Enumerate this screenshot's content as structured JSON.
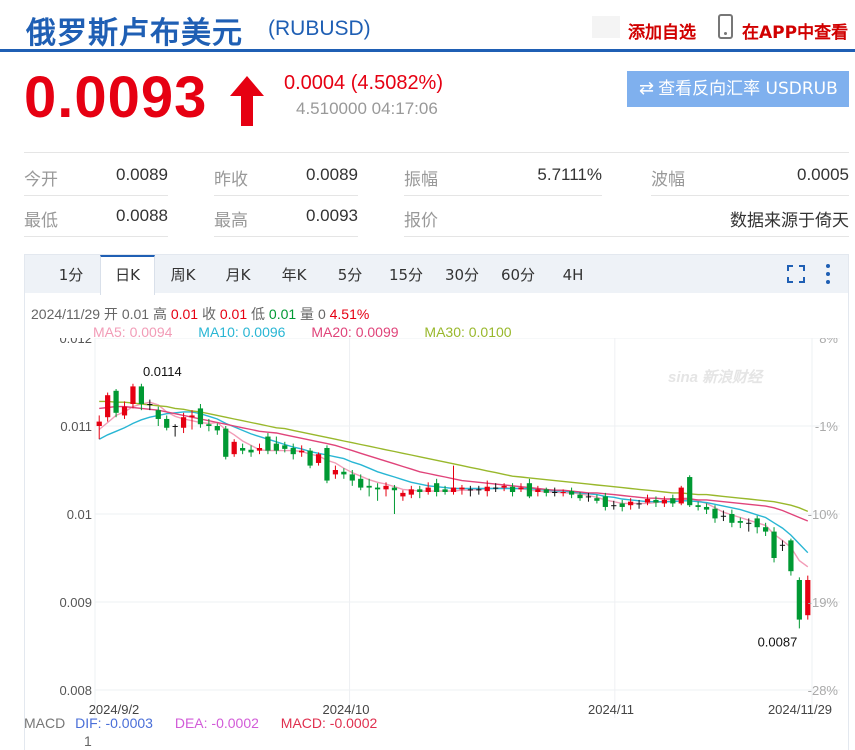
{
  "header": {
    "title": "俄罗斯卢布美元",
    "symbol": "(RUBUSD)",
    "add_favorite": "添加自选",
    "app_view": "在APP中查看"
  },
  "quote": {
    "price": "0.0093",
    "change": "0.0004 (4.5082%)",
    "sub_info": "4.510000 04:17:06",
    "reverse_button": "查看反向汇率 USDRUB"
  },
  "stats": {
    "row1": [
      {
        "label": "今开",
        "value": "0.0089"
      },
      {
        "label": "昨收",
        "value": "0.0089"
      },
      {
        "label": "振幅",
        "value": "5.7111%"
      },
      {
        "label": "波幅",
        "value": "0.0005"
      }
    ],
    "row2": [
      {
        "label": "最低",
        "value": "0.0088"
      },
      {
        "label": "最高",
        "value": "0.0093"
      },
      {
        "label": "报价",
        "value": "数据来源于倚天"
      }
    ]
  },
  "tabs": [
    "1分",
    "日K",
    "周K",
    "月K",
    "年K",
    "5分",
    "15分",
    "30分",
    "60分",
    "4H"
  ],
  "active_tab": "日K",
  "ohlc": {
    "date": "2024/11/29",
    "open_label": "开",
    "open": "0.01",
    "high_label": "高",
    "high": "0.01",
    "close_label": "收",
    "close": "0.01",
    "low_label": "低",
    "low": "0.01",
    "volume_label": "量",
    "volume": "0",
    "change_pct": "4.51%"
  },
  "ma": {
    "ma5": "MA5: 0.0094",
    "ma10": "MA10: 0.0096",
    "ma20": "MA20: 0.0099",
    "ma30": "MA30: 0.0100"
  },
  "macd": {
    "label": "MACD",
    "dif": "DIF: -0.0003",
    "dea": "DEA: -0.0002",
    "macd": "MACD: -0.0002",
    "axis_value": "1"
  },
  "colors": {
    "up": "#e60012",
    "down": "#009933",
    "ma5": "#f29cb7",
    "ma10": "#29b6d4",
    "ma20": "#e0447a",
    "ma30": "#99b82c"
  },
  "chart_data": {
    "type": "candlestick",
    "y_ticks": [
      "0.012",
      "0.011",
      "0.01",
      "0.009",
      "0.008"
    ],
    "y_tick_values": [
      0.012,
      0.011,
      0.01,
      0.009,
      0.008
    ],
    "pct_ticks": [
      "8%",
      "-1%",
      "-10%",
      "-19%",
      "-28%"
    ],
    "x_ticks": [
      "2024/9/2",
      "2024/10",
      "2024/11",
      "2024/11/29"
    ],
    "ylim": [
      0.008,
      0.012
    ],
    "max_label": "0.0114",
    "min_label": "0.0087",
    "watermark": "sina 新浪财经",
    "candles": [
      [
        0.011,
        0.01105,
        0.01112,
        0.01085
      ],
      [
        0.0111,
        0.01135,
        0.01138,
        0.01105
      ],
      [
        0.0114,
        0.01115,
        0.01142,
        0.0111
      ],
      [
        0.01112,
        0.01122,
        0.01128,
        0.01108
      ],
      [
        0.01125,
        0.01145,
        0.01148,
        0.0112
      ],
      [
        0.01145,
        0.01125,
        0.01148,
        0.01118
      ],
      [
        0.01125,
        0.01125,
        0.0113,
        0.01118
      ],
      [
        0.01118,
        0.01108,
        0.01122,
        0.011
      ],
      [
        0.01108,
        0.01098,
        0.01112,
        0.01095
      ],
      [
        0.011,
        0.011,
        0.01102,
        0.01088
      ],
      [
        0.01098,
        0.0111,
        0.01115,
        0.01092
      ],
      [
        0.0111,
        0.01112,
        0.01118,
        0.01096
      ],
      [
        0.0112,
        0.01102,
        0.01125,
        0.01098
      ],
      [
        0.01102,
        0.011,
        0.01108,
        0.01094
      ],
      [
        0.011,
        0.01095,
        0.01103,
        0.0109
      ],
      [
        0.01097,
        0.01065,
        0.011,
        0.01062
      ],
      [
        0.01068,
        0.01082,
        0.01085,
        0.01065
      ],
      [
        0.01075,
        0.01072,
        0.0108,
        0.01068
      ],
      [
        0.01073,
        0.0107,
        0.01078,
        0.01065
      ],
      [
        0.01072,
        0.01075,
        0.0108,
        0.01068
      ],
      [
        0.01088,
        0.01072,
        0.01092,
        0.01068
      ],
      [
        0.0108,
        0.01072,
        0.01088,
        0.01068
      ],
      [
        0.01078,
        0.01074,
        0.01082,
        0.0107
      ],
      [
        0.01075,
        0.01068,
        0.0108,
        0.01062
      ],
      [
        0.0107,
        0.01072,
        0.01078,
        0.01065
      ],
      [
        0.01072,
        0.01055,
        0.01075,
        0.01052
      ],
      [
        0.01058,
        0.01068,
        0.0107,
        0.01055
      ],
      [
        0.01075,
        0.01038,
        0.01078,
        0.01035
      ],
      [
        0.01045,
        0.0105,
        0.01055,
        0.0104
      ],
      [
        0.01048,
        0.01045,
        0.01052,
        0.0104
      ],
      [
        0.01045,
        0.01038,
        0.0105,
        0.01032
      ],
      [
        0.0104,
        0.0103,
        0.01045,
        0.01027
      ],
      [
        0.01032,
        0.0103,
        0.0104,
        0.0102
      ],
      [
        0.0103,
        0.01028,
        0.01035,
        0.01015
      ],
      [
        0.01028,
        0.01032,
        0.01036,
        0.0102
      ],
      [
        0.0103,
        0.01027,
        0.01033,
        0.01
      ],
      [
        0.0102,
        0.01024,
        0.01027,
        0.01015
      ],
      [
        0.01022,
        0.01028,
        0.01032,
        0.01018
      ],
      [
        0.01028,
        0.01025,
        0.01032,
        0.01018
      ],
      [
        0.01025,
        0.0103,
        0.01036,
        0.01022
      ],
      [
        0.01035,
        0.01025,
        0.0104,
        0.0102
      ],
      [
        0.01028,
        0.01025,
        0.01032,
        0.01022
      ],
      [
        0.01025,
        0.0103,
        0.01055,
        0.01022
      ],
      [
        0.01028,
        0.0103,
        0.01033,
        0.01022
      ],
      [
        0.01028,
        0.01028,
        0.01032,
        0.0102
      ],
      [
        0.01028,
        0.01028,
        0.01032,
        0.01022
      ],
      [
        0.01026,
        0.01031,
        0.01038,
        0.0102
      ],
      [
        0.0103,
        0.0103,
        0.01035,
        0.01025
      ],
      [
        0.0103,
        0.01032,
        0.01035,
        0.01026
      ],
      [
        0.01031,
        0.01025,
        0.01035,
        0.0102
      ],
      [
        0.01028,
        0.0103,
        0.01035,
        0.01025
      ],
      [
        0.01035,
        0.0102,
        0.0104,
        0.01018
      ],
      [
        0.01025,
        0.01028,
        0.01032,
        0.0102
      ],
      [
        0.01028,
        0.01024,
        0.0103,
        0.0102
      ],
      [
        0.01025,
        0.01025,
        0.0103,
        0.0102
      ],
      [
        0.01024,
        0.01025,
        0.01028,
        0.0102
      ],
      [
        0.01026,
        0.01022,
        0.0103,
        0.01018
      ],
      [
        0.01022,
        0.01018,
        0.01025,
        0.01015
      ],
      [
        0.0102,
        0.0102,
        0.01024,
        0.01014
      ],
      [
        0.01018,
        0.01015,
        0.01022,
        0.01012
      ],
      [
        0.0102,
        0.01008,
        0.01024,
        0.01004
      ],
      [
        0.0101,
        0.0101,
        0.01015,
        0.01005
      ],
      [
        0.01012,
        0.01008,
        0.01016,
        0.01003
      ],
      [
        0.0101,
        0.01014,
        0.01018,
        0.01005
      ],
      [
        0.01012,
        0.01012,
        0.01016,
        0.01006
      ],
      [
        0.01013,
        0.01017,
        0.01022,
        0.0101
      ],
      [
        0.01016,
        0.01013,
        0.0102,
        0.01008
      ],
      [
        0.01012,
        0.01016,
        0.0102,
        0.01008
      ],
      [
        0.01018,
        0.01012,
        0.01022,
        0.01008
      ],
      [
        0.01012,
        0.0103,
        0.01032,
        0.0101
      ],
      [
        0.01042,
        0.0101,
        0.01044,
        0.01008
      ],
      [
        0.0101,
        0.01008,
        0.01014,
        0.01004
      ],
      [
        0.01008,
        0.01005,
        0.01012,
        0.01
      ],
      [
        0.01006,
        0.00995,
        0.0101,
        0.0099
      ],
      [
        0.00998,
        0.00998,
        0.01004,
        0.00992
      ],
      [
        0.01,
        0.0099,
        0.01005,
        0.00985
      ],
      [
        0.00992,
        0.0099,
        0.00996,
        0.00984
      ],
      [
        0.0099,
        0.0099,
        0.00995,
        0.0098
      ],
      [
        0.00995,
        0.00985,
        0.00998,
        0.00978
      ],
      [
        0.00985,
        0.0098,
        0.0099,
        0.00975
      ],
      [
        0.0098,
        0.0095,
        0.00985,
        0.00945
      ],
      [
        0.00965,
        0.00965,
        0.0097,
        0.00958
      ],
      [
        0.0097,
        0.00935,
        0.00972,
        0.0093
      ],
      [
        0.00925,
        0.0088,
        0.00928,
        0.0087
      ],
      [
        0.00885,
        0.00925,
        0.0093,
        0.0088
      ]
    ],
    "series": [
      {
        "name": "MA5",
        "values": [
          0.01096,
          0.01104,
          0.01112,
          0.01116,
          0.01122,
          0.01125,
          0.01127,
          0.01124,
          0.01116,
          0.01111,
          0.01108,
          0.01106,
          0.01104,
          0.01103,
          0.01104,
          0.01096,
          0.0109,
          0.01083,
          0.01078,
          0.01073,
          0.01072,
          0.01072,
          0.01072,
          0.01072,
          0.01071,
          0.01068,
          0.01066,
          0.01061,
          0.01058,
          0.01052,
          0.01047,
          0.01043,
          0.01039,
          0.01036,
          0.01034,
          0.01031,
          0.01028,
          0.01027,
          0.01026,
          0.01026,
          0.01026,
          0.01026,
          0.01026,
          0.01027,
          0.01027,
          0.01028,
          0.01029,
          0.01029,
          0.0103,
          0.01029,
          0.01029,
          0.01027,
          0.01026,
          0.01025,
          0.01025,
          0.01024,
          0.01024,
          0.01023,
          0.01021,
          0.01019,
          0.01016,
          0.01014,
          0.01012,
          0.01012,
          0.01012,
          0.01012,
          0.01013,
          0.01014,
          0.01015,
          0.01018,
          0.01018,
          0.01015,
          0.01012,
          0.01007,
          0.01002,
          0.00999,
          0.00996,
          0.00993,
          0.0099,
          0.00987,
          0.00977,
          0.0097,
          0.00962,
          0.00947,
          0.0094
        ]
      },
      {
        "name": "MA10",
        "values": [
          0.01085,
          0.0109,
          0.01094,
          0.01098,
          0.01103,
          0.01107,
          0.0111,
          0.01112,
          0.01114,
          0.01115,
          0.01116,
          0.01116,
          0.01114,
          0.01111,
          0.01108,
          0.01103,
          0.01099,
          0.01095,
          0.01091,
          0.01088,
          0.01085,
          0.01082,
          0.01079,
          0.01076,
          0.01074,
          0.01071,
          0.01069,
          0.01067,
          0.01065,
          0.01063,
          0.01059,
          0.01056,
          0.01052,
          0.01048,
          0.01045,
          0.01042,
          0.01039,
          0.01036,
          0.01034,
          0.01032,
          0.01031,
          0.0103,
          0.01029,
          0.01029,
          0.01029,
          0.01029,
          0.01029,
          0.01029,
          0.01029,
          0.01029,
          0.01029,
          0.01029,
          0.01028,
          0.01027,
          0.01026,
          0.01026,
          0.01025,
          0.01024,
          0.01023,
          0.01022,
          0.0102,
          0.01019,
          0.01017,
          0.01016,
          0.01015,
          0.01014,
          0.01014,
          0.01014,
          0.01014,
          0.01015,
          0.01015,
          0.01014,
          0.01013,
          0.01011,
          0.01009,
          0.01007,
          0.01005,
          0.01002,
          0.00999,
          0.00996,
          0.0099,
          0.00984,
          0.00976,
          0.00966,
          0.00956
        ]
      },
      {
        "name": "MA20",
        "values": [
          0.0112,
          0.01121,
          0.01122,
          0.01122,
          0.01121,
          0.0112,
          0.01119,
          0.01118,
          0.01116,
          0.01114,
          0.01112,
          0.0111,
          0.01108,
          0.01106,
          0.01104,
          0.01102,
          0.011,
          0.01098,
          0.01096,
          0.01094,
          0.01093,
          0.01092,
          0.0109,
          0.01088,
          0.01086,
          0.01084,
          0.01082,
          0.0108,
          0.01078,
          0.01075,
          0.01072,
          0.01069,
          0.01066,
          0.01063,
          0.0106,
          0.01057,
          0.01054,
          0.01051,
          0.01048,
          0.01046,
          0.01044,
          0.01042,
          0.0104,
          0.01038,
          0.01037,
          0.01036,
          0.01035,
          0.01034,
          0.01033,
          0.01032,
          0.01031,
          0.0103,
          0.01029,
          0.01028,
          0.01027,
          0.01027,
          0.01026,
          0.01025,
          0.01024,
          0.01024,
          0.01023,
          0.01022,
          0.01021,
          0.0102,
          0.01019,
          0.01018,
          0.01018,
          0.01017,
          0.01017,
          0.01017,
          0.01017,
          0.01016,
          0.01016,
          0.01015,
          0.01014,
          0.01013,
          0.01012,
          0.01011,
          0.0101,
          0.01009,
          0.01007,
          0.01004,
          0.01,
          0.00996,
          0.00992
        ]
      },
      {
        "name": "MA30",
        "values": [
          0.01128,
          0.01128,
          0.01127,
          0.01127,
          0.01126,
          0.01125,
          0.01124,
          0.01123,
          0.01122,
          0.0112,
          0.01119,
          0.01117,
          0.01116,
          0.01114,
          0.01112,
          0.0111,
          0.01108,
          0.01106,
          0.01104,
          0.01102,
          0.011,
          0.01098,
          0.01097,
          0.01095,
          0.01093,
          0.01091,
          0.01089,
          0.01087,
          0.01085,
          0.01083,
          0.01081,
          0.01079,
          0.01077,
          0.01075,
          0.01073,
          0.01071,
          0.01069,
          0.01067,
          0.01065,
          0.01063,
          0.01061,
          0.01059,
          0.01057,
          0.01055,
          0.01053,
          0.01051,
          0.01049,
          0.01047,
          0.01045,
          0.01043,
          0.01042,
          0.01041,
          0.0104,
          0.01039,
          0.01038,
          0.01037,
          0.01036,
          0.01035,
          0.01034,
          0.01033,
          0.01032,
          0.01031,
          0.0103,
          0.01029,
          0.01028,
          0.01027,
          0.01026,
          0.01025,
          0.01024,
          0.01024,
          0.01023,
          0.01022,
          0.01022,
          0.01021,
          0.0102,
          0.01019,
          0.01018,
          0.01017,
          0.01016,
          0.01015,
          0.01014,
          0.01012,
          0.0101,
          0.01007,
          0.01003
        ]
      }
    ]
  }
}
